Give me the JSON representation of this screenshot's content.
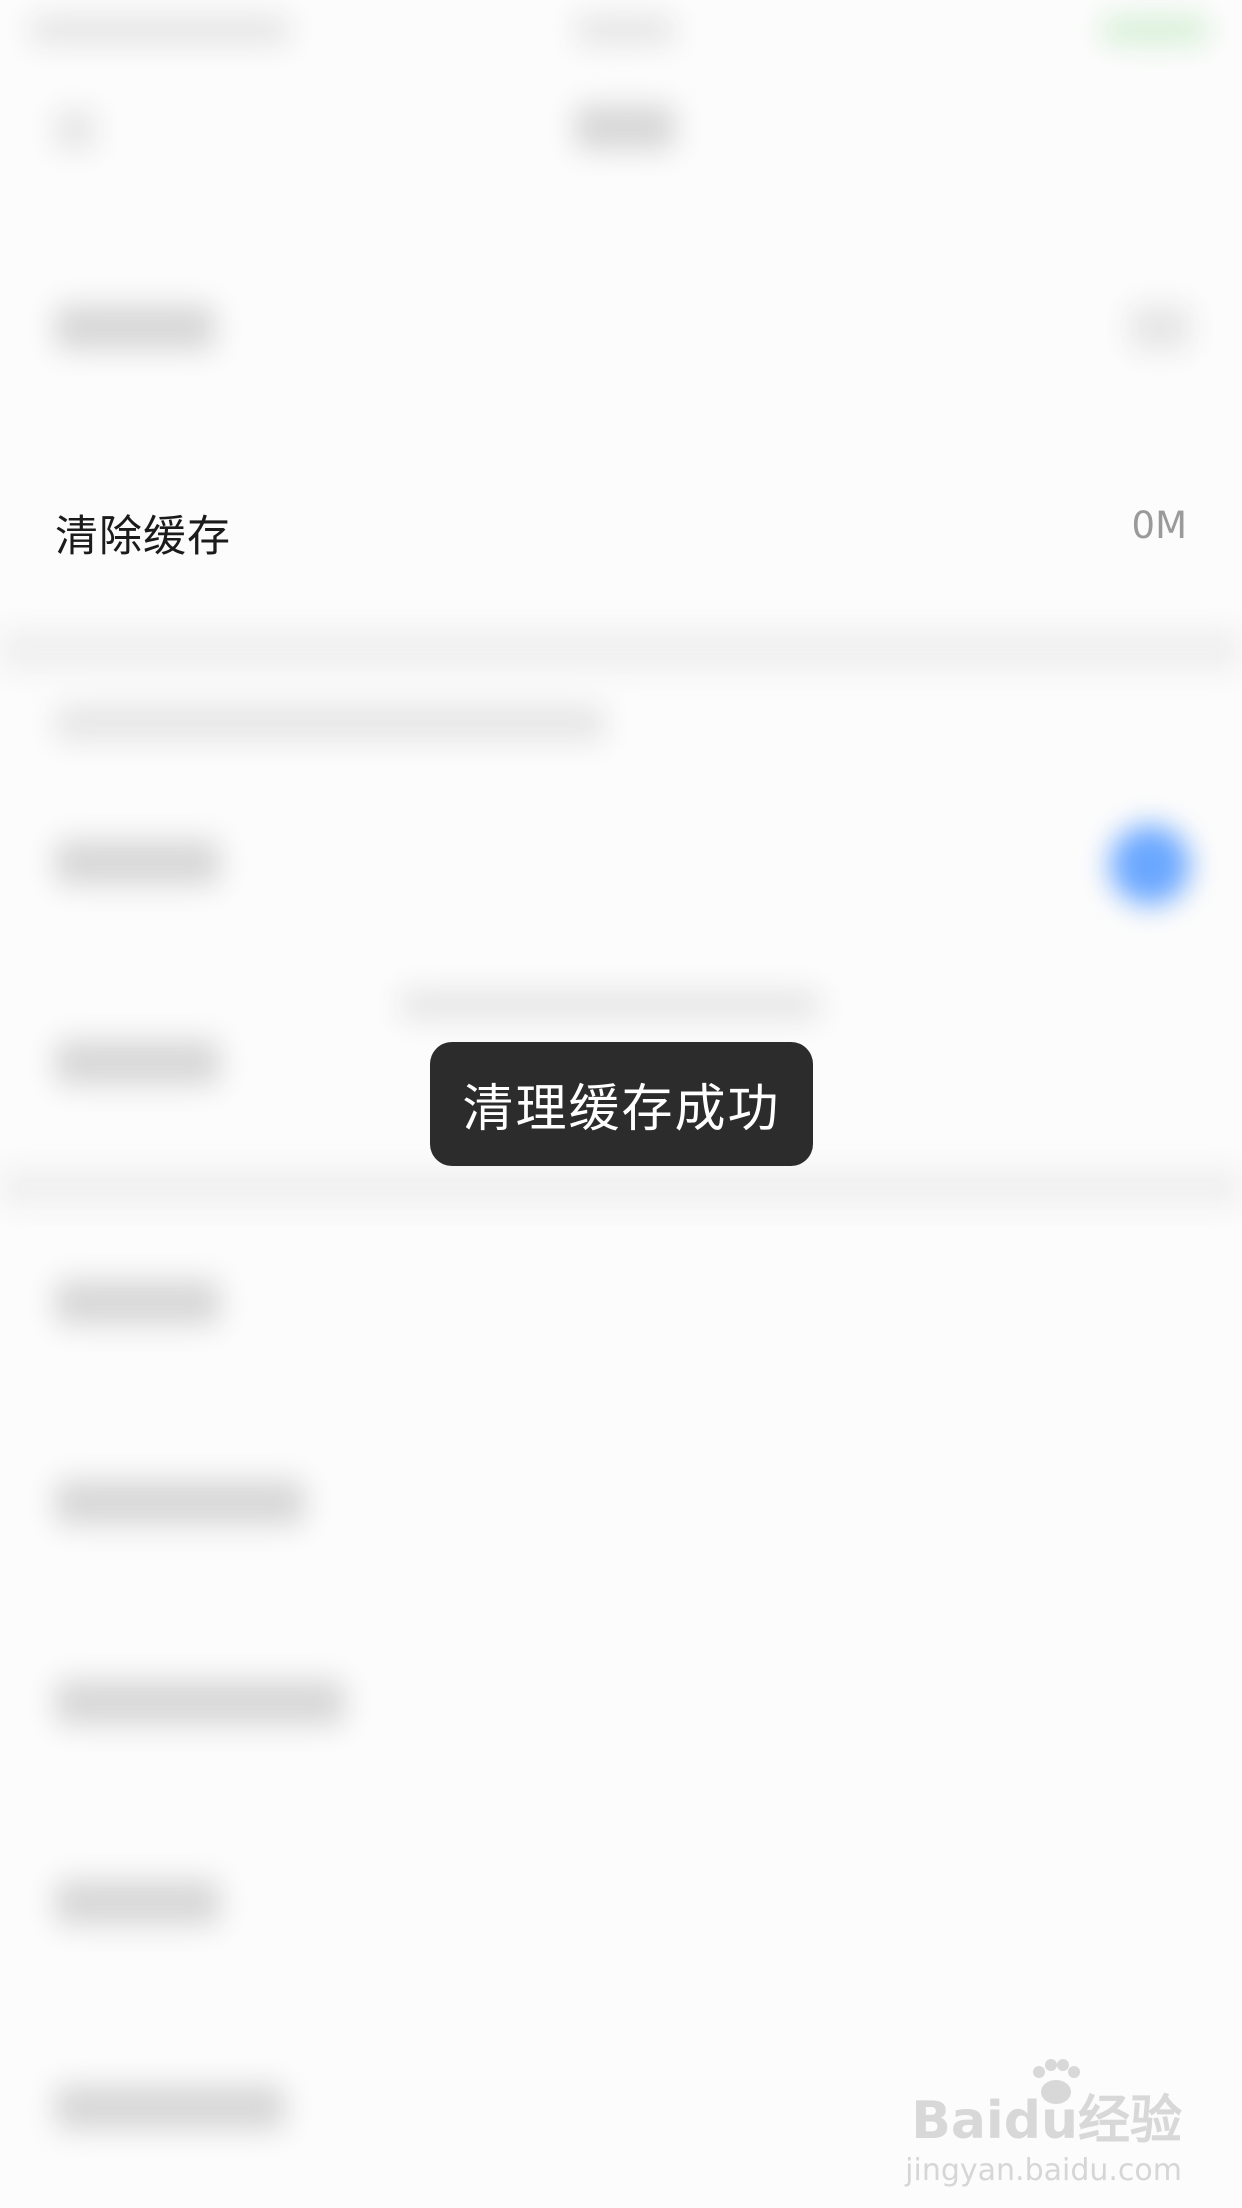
{
  "settings": {
    "clear_cache_label": "清除缓存",
    "clear_cache_value": "0M"
  },
  "toast": {
    "message": "清理缓存成功"
  },
  "watermark": {
    "logo_text": "Baidu经验",
    "sub_text": "jingyan.baidu.com"
  }
}
